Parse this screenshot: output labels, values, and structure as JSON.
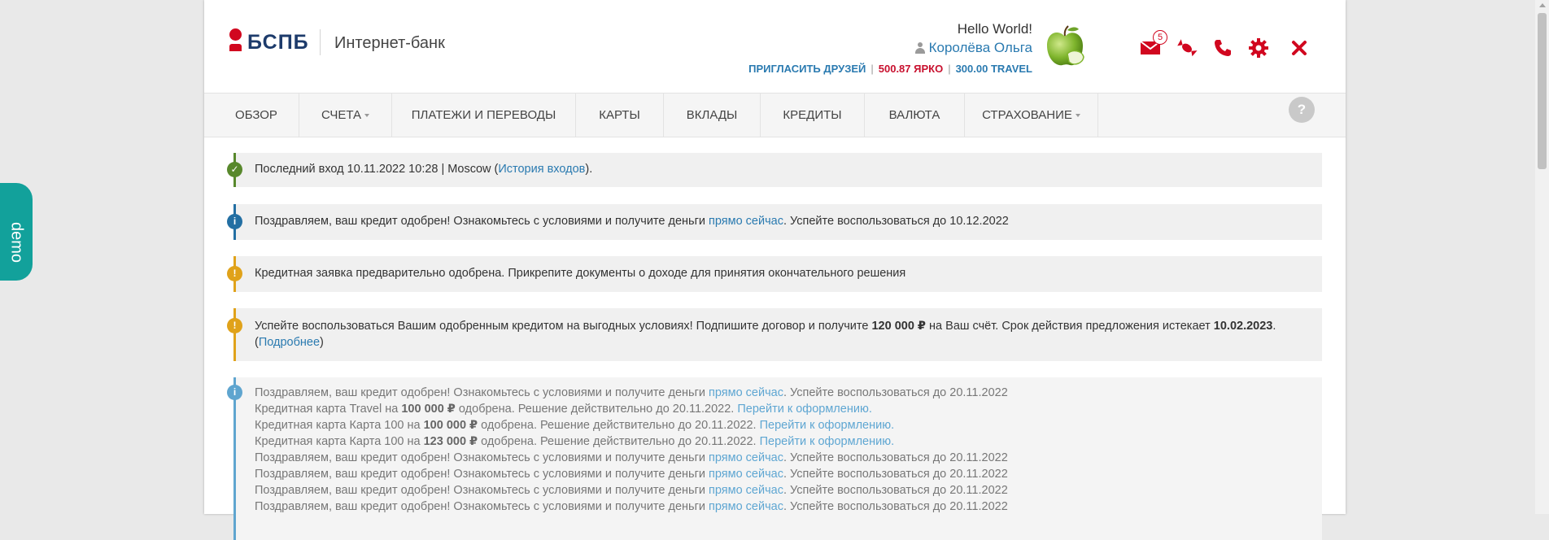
{
  "brand": {
    "logo_text": "БСПБ",
    "subtitle": "Интернет-банк"
  },
  "user": {
    "greeting": "Hello World!",
    "name": "Королёва Ольга",
    "invite": "ПРИГЛАСИТЬ ДРУЗЕЙ",
    "yarko": "500.87 ЯРКО",
    "travel": "300.00 TRAVEL",
    "separator": "|"
  },
  "header_icons": [
    {
      "name": "mail-icon",
      "badge": "5"
    },
    {
      "name": "candy-icon"
    },
    {
      "name": "phone-icon"
    },
    {
      "name": "gear-icon"
    },
    {
      "name": "close-icon"
    }
  ],
  "colors": {
    "accent": "#d1071f",
    "link": "#2a7ab0",
    "brand_blue": "#1d3b6b",
    "demo": "#12a19b"
  },
  "nav": {
    "items": [
      {
        "label": "ОБЗОР"
      },
      {
        "label": "СЧЕТА"
      },
      {
        "label": "ПЛАТЕЖИ И ПЕРЕВОДЫ"
      },
      {
        "label": "КАРТЫ"
      },
      {
        "label": "ВКЛАДЫ"
      },
      {
        "label": "КРЕДИТЫ"
      },
      {
        "label": "ВАЛЮТА"
      },
      {
        "label": "СТРАХОВАНИЕ"
      }
    ],
    "help": "?"
  },
  "alerts": {
    "login": {
      "text": "Последний вход 10.11.2022 10:28 | Moscow (",
      "link": "История входов",
      "tail": ")."
    },
    "approved": {
      "text": "Поздравляем, ваш кредит одобрен! Ознакомьтесь с условиями и получите деньги ",
      "link": "прямо сейчас",
      "tail": ". Успейте воспользоваться до 10.12.2022"
    },
    "prelim": {
      "text": "Кредитная заявка предварительно одобрена. Прикрепите документы о доходе для принятия окончательного решения"
    },
    "offer": {
      "text1": "Успейте воспользоваться Вашим одобренным кредитом на выгодных условиях! Подпишите договор и получите ",
      "amount": "120 000 ₽",
      "text2": " на Ваш счёт. Срок действия предложения истекает ",
      "date": "10.02.2023",
      "text3": ".",
      "open": "(",
      "link": "Подробнее",
      "close": ")"
    },
    "list": {
      "congrats_text": "Поздравляем, ваш кредит одобрен! Ознакомьтесь с условиями и получите деньги ",
      "congrats_link": "прямо сейчас",
      "congrats_tail": ". Успейте воспользоваться до 20.11.2022",
      "card1_a": "Кредитная карта Travel на ",
      "card1_amount": "100 000 ₽",
      "card1_b": " одобрена. Решение действительно до 20.11.2022. ",
      "card_link": "Перейти к оформлению.",
      "card2_a": "Кредитная карта Карта 100 на ",
      "card2_amount": "100 000 ₽",
      "card2_b": " одобрена. Решение действительно до 20.11.2022. ",
      "card3_a": "Кредитная карта Карта 100 на ",
      "card3_amount": "123 000 ₽",
      "card3_b": " одобрена. Решение действительно до 20.11.2022. "
    }
  },
  "demo": {
    "label": "demo"
  }
}
